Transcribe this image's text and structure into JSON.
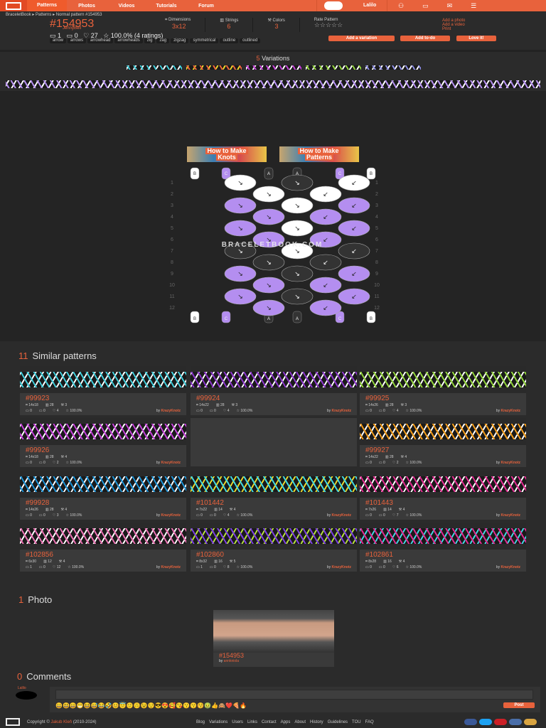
{
  "nav": {
    "items": [
      "Patterns",
      "Photos",
      "Videos",
      "Tutorials",
      "Forum"
    ],
    "active": 0,
    "user": "Lalilo"
  },
  "breadcrumb": [
    "BraceletBook",
    "Patterns",
    "Normal pattern #154953"
  ],
  "pattern": {
    "id": "#154953",
    "author": "JennyBell",
    "photos": "1",
    "videos": "0",
    "loves": "27",
    "rating": "100.0% (4 ratings)",
    "tags": [
      "arrow",
      "arrows",
      "arrowhead",
      "arrowheads",
      "zig",
      "zag",
      "zigzag",
      "symmetrical",
      "outline",
      "outlined"
    ],
    "dimensions_label": "Dimensions",
    "dimensions": "3x12",
    "strings_label": "Strings",
    "strings": "6",
    "colors_label": "Colors",
    "colors": "3",
    "rate_label": "Rate Pattern",
    "stars": "☆☆☆☆☆"
  },
  "side_links": [
    "Add a photo",
    "Add a video",
    "Print"
  ],
  "buttons": {
    "variation": "Add a variation",
    "todo": "Add to-do",
    "love": "Love it!"
  },
  "variations": {
    "count": "5",
    "label": "Variations"
  },
  "howto": [
    [
      "How to Make",
      "Knots"
    ],
    [
      "How to Make",
      "Patterns"
    ]
  ],
  "watermark": "BRACELETBOOK.COM",
  "diagram": {
    "top_strings": [
      "B",
      "C",
      "A",
      "A",
      "C",
      "B"
    ],
    "bottom_strings": [
      "B",
      "C",
      "A",
      "A",
      "C",
      "B"
    ],
    "colors": {
      "A": "#333333",
      "B": "#ffffff",
      "C": "#b48ef0"
    },
    "rows": [
      [
        "B",
        "A",
        "B"
      ],
      [
        "B",
        "B"
      ],
      [
        "C",
        "B",
        "C"
      ],
      [
        "C",
        "C"
      ],
      [
        "C",
        "B",
        "C"
      ],
      [
        "C",
        "C"
      ],
      [
        "A",
        "B",
        "A"
      ],
      [
        "A",
        "A"
      ],
      [
        "C",
        "A",
        "C"
      ],
      [
        "C",
        "C"
      ],
      [
        "C",
        "A",
        "C"
      ],
      [
        "C",
        "C"
      ]
    ]
  },
  "similar": {
    "count": "11",
    "label": "Similar patterns",
    "items": [
      {
        "id": "#99923",
        "dim": "14x18",
        "strings": "28",
        "colors": "3",
        "photos": "0",
        "videos": "0",
        "loves": "4",
        "rating": "100.0%",
        "by": "KrazyKnotz",
        "c1": "#3fc9d6",
        "c2": "#ffffff"
      },
      {
        "id": "#99924",
        "dim": "14x22",
        "strings": "28",
        "colors": "3",
        "photos": "0",
        "videos": "0",
        "loves": "4",
        "rating": "100.0%",
        "by": "KrazyKnotz",
        "c1": "#8a35c9",
        "c2": "#ffffff"
      },
      {
        "id": "#99925",
        "dim": "14x26",
        "strings": "28",
        "colors": "3",
        "photos": "0",
        "videos": "0",
        "loves": "4",
        "rating": "100.0%",
        "by": "KrazyKnotz",
        "c1": "#8fd13a",
        "c2": "#ffffff"
      },
      {
        "id": "#99926",
        "dim": "14x18",
        "strings": "28",
        "colors": "4",
        "photos": "0",
        "videos": "0",
        "loves": "2",
        "rating": "100.0%",
        "by": "KrazyKnotz",
        "c1": "#c23fd6",
        "c2": "#ffffff"
      },
      null,
      {
        "id": "#99927",
        "dim": "14x22",
        "strings": "28",
        "colors": "4",
        "photos": "0",
        "videos": "0",
        "loves": "2",
        "rating": "100.0%",
        "by": "KrazyKnotz",
        "c1": "#f09a1a",
        "c2": "#ffffff"
      },
      {
        "id": "#99928",
        "dim": "14x26",
        "strings": "28",
        "colors": "4",
        "photos": "0",
        "videos": "0",
        "loves": "3",
        "rating": "100.0%",
        "by": "KrazyKnotz",
        "c1": "#1a8fd1",
        "c2": "#ffffff"
      },
      {
        "id": "#101442",
        "dim": "7x22",
        "strings": "14",
        "colors": "4",
        "photos": "0",
        "videos": "0",
        "loves": "4",
        "rating": "100.0%",
        "by": "KrazyKnotz",
        "c1": "#3fd6e0",
        "c2": "#e8d52a"
      },
      {
        "id": "#101443",
        "dim": "7x26",
        "strings": "14",
        "colors": "4",
        "photos": "0",
        "videos": "0",
        "loves": "7",
        "rating": "100.0%",
        "by": "KrazyKnotz",
        "c1": "#e02a8f",
        "c2": "#ffffff"
      },
      {
        "id": "#102856",
        "dim": "6x30",
        "strings": "12",
        "colors": "4",
        "photos": "1",
        "videos": "0",
        "loves": "12",
        "rating": "100.0%",
        "by": "KrazyKnotz",
        "c1": "#e86fb0",
        "c2": "#ffffff"
      },
      {
        "id": "#102860",
        "dim": "8x32",
        "strings": "16",
        "colors": "5",
        "photos": "1",
        "videos": "0",
        "loves": "8",
        "rating": "100.0%",
        "by": "KrazyKnotz",
        "c1": "#7a3fe0",
        "c2": "#b5e03a"
      },
      {
        "id": "#102861",
        "dim": "8x28",
        "strings": "16",
        "colors": "4",
        "photos": "0",
        "videos": "0",
        "loves": "6",
        "rating": "100.0%",
        "by": "KrazyKnotz",
        "c1": "#e02a8f",
        "c2": "#3fd6e0"
      }
    ]
  },
  "photos": {
    "count": "1",
    "label": "Photo",
    "item": {
      "id": "#154953",
      "by_label": "by",
      "by": "annkniola"
    }
  },
  "comments": {
    "count": "0",
    "label": "Comments",
    "user": "Lalilo",
    "post": "Post",
    "emoji": "😀😃😄😁😆😅😂🤣😊😇🙂🙃😉😌😎😍🥰😘😗😙😚🤢👍🙈❤️🍕🔥"
  },
  "footer": {
    "copyright": "Copyright ©",
    "name": "Jakub Kleň",
    "years": "(2010-2024)",
    "links": [
      "Blog",
      "Variations",
      "Users",
      "Links",
      "Contact",
      "Apps",
      "About",
      "History",
      "Guidelines",
      "TOU",
      "FAQ"
    ]
  },
  "accent": "#e8623c"
}
